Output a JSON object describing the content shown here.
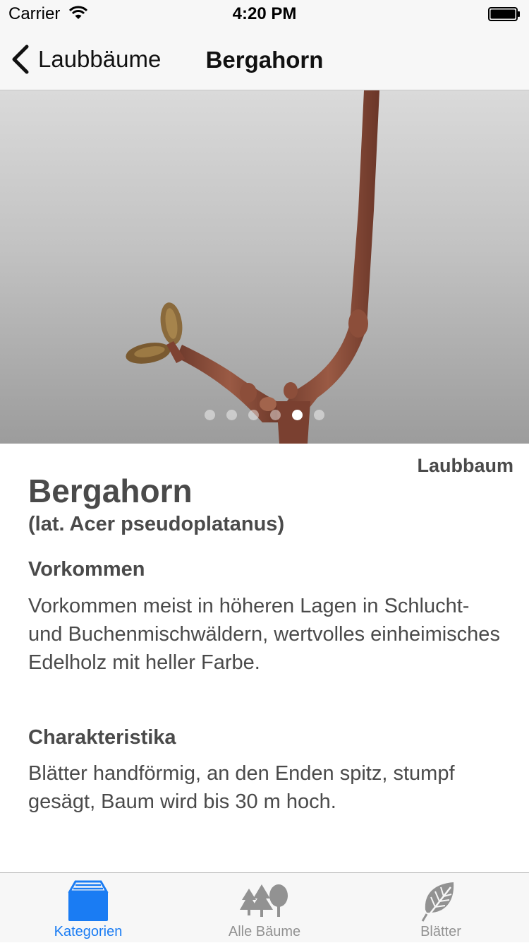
{
  "status_bar": {
    "carrier": "Carrier",
    "time": "4:20 PM"
  },
  "nav": {
    "back_label": "Laubbäume",
    "title": "Bergahorn"
  },
  "gallery": {
    "page_count": 6,
    "current_page": 5
  },
  "detail": {
    "category": "Laubbaum",
    "name": "Bergahorn",
    "latin": "(lat. Acer pseudoplatanus)",
    "sections": [
      {
        "title": "Vorkommen",
        "text": "Vorkommen meist in höheren Lagen in Schlucht- und Buchenmischwäldern, wertvolles einheimisches Edelholz mit heller Farbe."
      },
      {
        "title": "Charakteristika",
        "text": "Blätter handförmig, an den Enden spitz, stumpf gesägt, Baum wird bis 30 m hoch."
      }
    ]
  },
  "tabs": [
    {
      "label": "Kategorien",
      "icon": "categories-box-icon",
      "active": true
    },
    {
      "label": "Alle Bäume",
      "icon": "trees-icon",
      "active": false
    },
    {
      "label": "Blätter",
      "icon": "leaf-icon",
      "active": false
    }
  ],
  "colors": {
    "accent": "#1a7cf3",
    "text": "#4a4a4a",
    "bar_bg": "#f7f7f7",
    "branch": "#8a4e3c"
  }
}
